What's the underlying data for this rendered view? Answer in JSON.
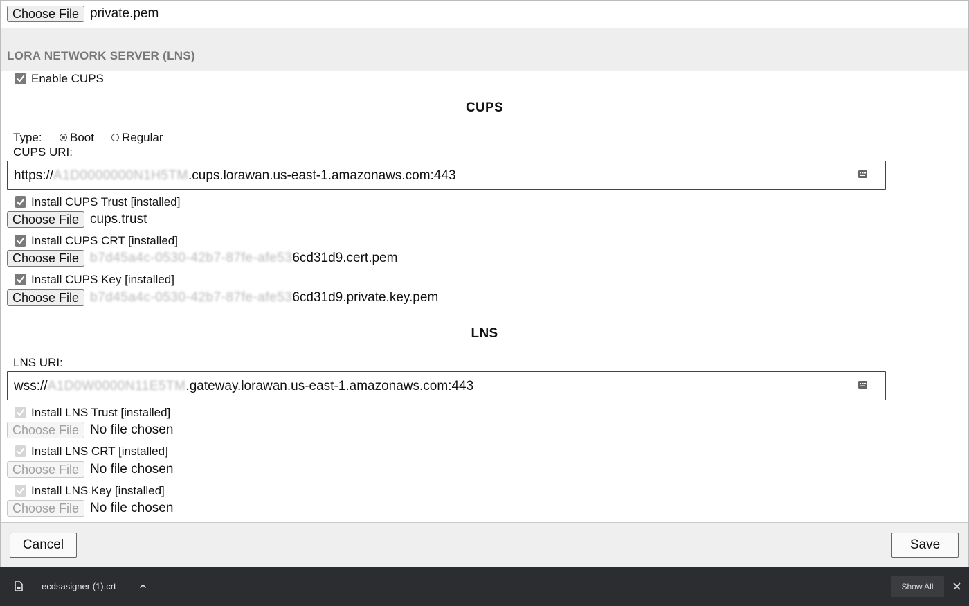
{
  "top": {
    "choose_file_label": "Choose File",
    "file_name": "private.pem"
  },
  "section": {
    "title": "LORA NETWORK SERVER (LNS)"
  },
  "enable_cups": {
    "label": "Enable CUPS",
    "checked": true
  },
  "cups": {
    "heading": "CUPS",
    "type_label": "Type:",
    "type_options": [
      "Boot",
      "Regular"
    ],
    "type_selected": "Boot",
    "uri_label": "CUPS URI:",
    "uri_prefix": "https://",
    "uri_redacted": "A1D0000000N1H5TM",
    "uri_suffix": ".cups.lorawan.us-east-1.amazonaws.com:443",
    "items": [
      {
        "label": "Install CUPS Trust [installed]",
        "button": "Choose File",
        "file_redacted": "",
        "file_suffix": "cups.trust"
      },
      {
        "label": "Install CUPS CRT [installed]",
        "button": "Choose File",
        "file_redacted": "b7d45a4c-0530-42b7-87fe-afe53",
        "file_suffix": "6cd31d9.cert.pem"
      },
      {
        "label": "Install CUPS Key [installed]",
        "button": "Choose File",
        "file_redacted": "b7d45a4c-0530-42b7-87fe-afe53",
        "file_suffix": "6cd31d9.private.key.pem"
      }
    ]
  },
  "lns": {
    "heading": "LNS",
    "uri_label": "LNS URI:",
    "uri_prefix": "wss://",
    "uri_redacted": "A1D0W0000N11E5TM",
    "uri_suffix": ".gateway.lorawan.us-east-1.amazonaws.com:443",
    "items": [
      {
        "label": "Install LNS Trust [installed]",
        "button": "Choose File",
        "file_text": "No file chosen"
      },
      {
        "label": "Install LNS CRT [installed]",
        "button": "Choose File",
        "file_text": "No file chosen"
      },
      {
        "label": "Install LNS Key [installed]",
        "button": "Choose File",
        "file_text": "No file chosen"
      }
    ]
  },
  "footer": {
    "cancel_label": "Cancel",
    "save_label": "Save"
  },
  "download_bar": {
    "file_name": "ecdsasigner (1).crt",
    "show_all_label": "Show All",
    "bg_color": "#2c2d30"
  },
  "icons": {
    "download_file": "document-icon",
    "expand": "chevron-up-icon",
    "close": "close-icon",
    "uri_field": "keyboard-icon"
  }
}
